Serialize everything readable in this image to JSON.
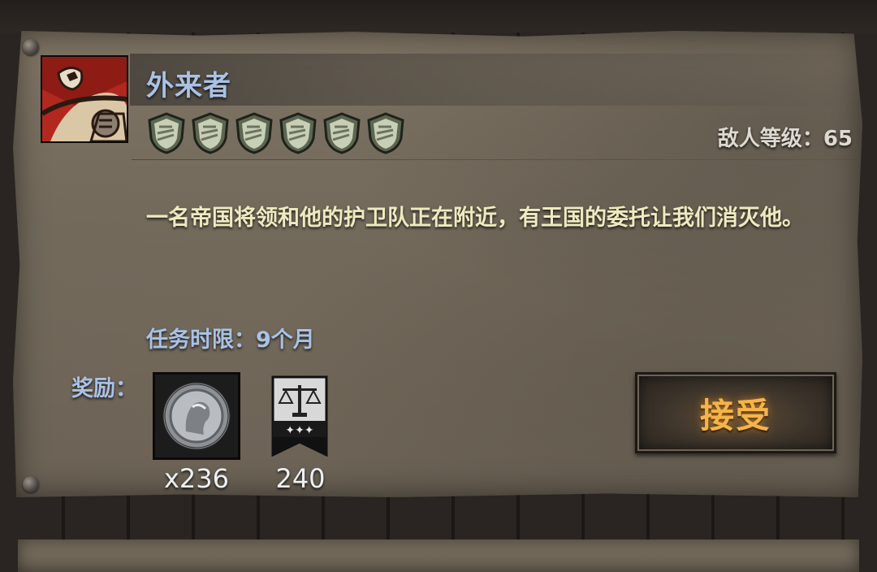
{
  "quest": {
    "title": "外来者",
    "difficulty_shields": 6,
    "enemy_level_text": "敌人等级：65",
    "description": "一名帝国将领和他的护卫队正在附近，有王国的委托让我们消灭他。",
    "deadline_text": "任务时限：9个月",
    "rewards_label": "奖励：",
    "rewards": [
      {
        "icon": "silver-coin-icon",
        "value": "x236"
      },
      {
        "icon": "justice-banner-icon",
        "value": "240"
      }
    ],
    "accept_label": "接受"
  },
  "colors": {
    "title_blue": "#a9c2e6",
    "description_cream": "#eeeac0",
    "accept_orange": "#f5b44a",
    "portrait_red": "#b3281e"
  }
}
